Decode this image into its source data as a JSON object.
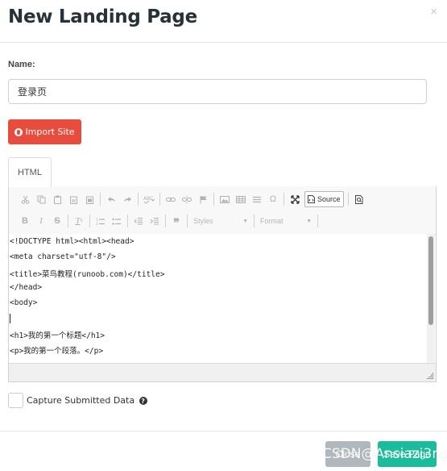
{
  "dialog": {
    "title": "New Landing Page",
    "close_glyph": "×"
  },
  "name_field": {
    "label": "Name:",
    "value": "登录页"
  },
  "import_button": {
    "label": "Import Site",
    "icon": "globe-icon",
    "color": "#e74c3c"
  },
  "tabs": [
    {
      "label": "HTML",
      "active": true
    }
  ],
  "toolbar": {
    "source_label": "Source",
    "styles_label": "Styles",
    "format_label": "Format",
    "row1_icons": [
      "cut-icon",
      "copy-icon",
      "paste-icon",
      "paste-text-icon",
      "paste-word-icon",
      "undo-icon",
      "redo-icon",
      "spellcheck-icon",
      "link-icon",
      "unlink-icon",
      "anchor-icon",
      "image-icon",
      "table-icon",
      "horizontal-line-icon",
      "special-char-icon",
      "maximize-icon",
      "source-icon",
      "preview-icon"
    ],
    "row2_icons": [
      "bold-icon",
      "italic-icon",
      "strikethrough-icon",
      "remove-format-icon",
      "numbered-list-icon",
      "bulleted-list-icon",
      "outdent-icon",
      "indent-icon",
      "blockquote-icon"
    ]
  },
  "editor": {
    "lines": [
      "<!DOCTYPE html><html><head>",
      "<meta charset=\"utf-8\"/>",
      "<title>菜鸟教程(runoob.com)</title>",
      "</head>",
      "<body>",
      "",
      "<h1>我的第一个标题</h1>",
      "<p>我的第一个段落。</p>"
    ]
  },
  "capture": {
    "label": "Capture Submitted Data",
    "checked": false,
    "help_glyph": "?"
  },
  "footer": {
    "close_label": "Close",
    "save_label": "Save Page",
    "save_color": "#1abc9c",
    "watermark": "CSDN@Ansiazi3ng"
  }
}
